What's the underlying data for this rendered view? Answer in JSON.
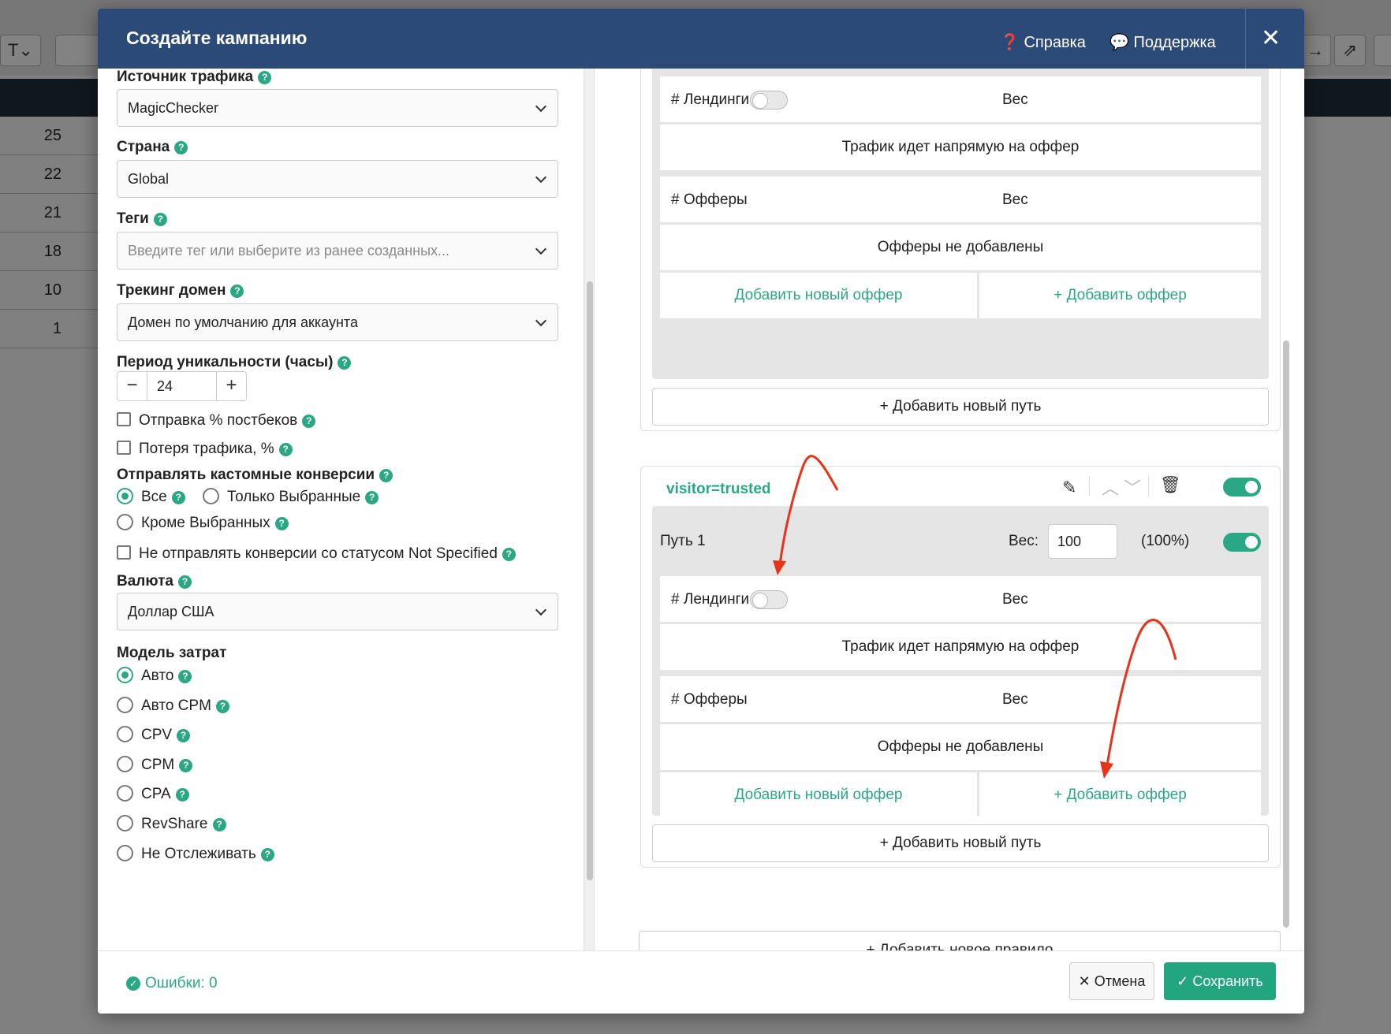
{
  "background": {
    "toolbar_button_text": "T",
    "row_values": [
      "25",
      "22",
      "21",
      "18",
      "10",
      "1"
    ]
  },
  "header": {
    "title": "Создайте кампанию",
    "help_link": "Справка",
    "support_link": "Поддержка"
  },
  "form": {
    "traffic_source": {
      "label": "Источник трафика",
      "value": "MagicChecker"
    },
    "country": {
      "label": "Страна",
      "value": "Global"
    },
    "tags": {
      "label": "Теги",
      "placeholder": "Введите тег или выберите из ранее созданных..."
    },
    "tracking_domain": {
      "label": "Трекинг домен",
      "value": "Домен по умолчанию для аккаунта"
    },
    "uniqueness": {
      "label": "Период уникальности (часы)",
      "value": "24",
      "minus": "−",
      "plus": "+"
    },
    "postback_percent": {
      "label": "Отправка % постбеков"
    },
    "traffic_loss": {
      "label": "Потеря трафика, %"
    },
    "custom_conversions": {
      "label": "Отправлять кастомные конверсии",
      "options": [
        "Все",
        "Только Выбранные",
        "Кроме Выбранных"
      ],
      "selected": "Все"
    },
    "not_specified": {
      "label": "Не отправлять конверсии со статусом Not Specified"
    },
    "currency": {
      "label": "Валюта",
      "value": "Доллар США"
    },
    "cost_model": {
      "label": "Модель затрат",
      "options": [
        "Авто",
        "Авто CPM",
        "CPV",
        "CPM",
        "CPA",
        "RevShare",
        "Не Отслеживать"
      ],
      "selected": "Авто"
    }
  },
  "flow": {
    "landings_header": "# Лендинги",
    "offers_header": "# Офферы",
    "weight_header": "Вес",
    "direct_text": "Трафик идет напрямую на оффер",
    "no_offers_text": "Офферы не добавлены",
    "add_new_offer": "Добавить новый оффер",
    "add_offer": "+ Добавить оффер",
    "add_new_path": "+ Добавить новый путь",
    "rule_name": "visitor=trusted",
    "path_name": "Путь 1",
    "weight_label": "Вес:",
    "weight_value": "100",
    "weight_percent": "(100%)",
    "add_new_rule": "+ Добавить новое правило"
  },
  "footer": {
    "errors": "Ошибки: 0",
    "cancel": "Отмена",
    "save": "Сохранить"
  },
  "colors": {
    "header_bg": "#2c4a77",
    "accent": "#2aa784",
    "arrow": "#e8321a"
  }
}
